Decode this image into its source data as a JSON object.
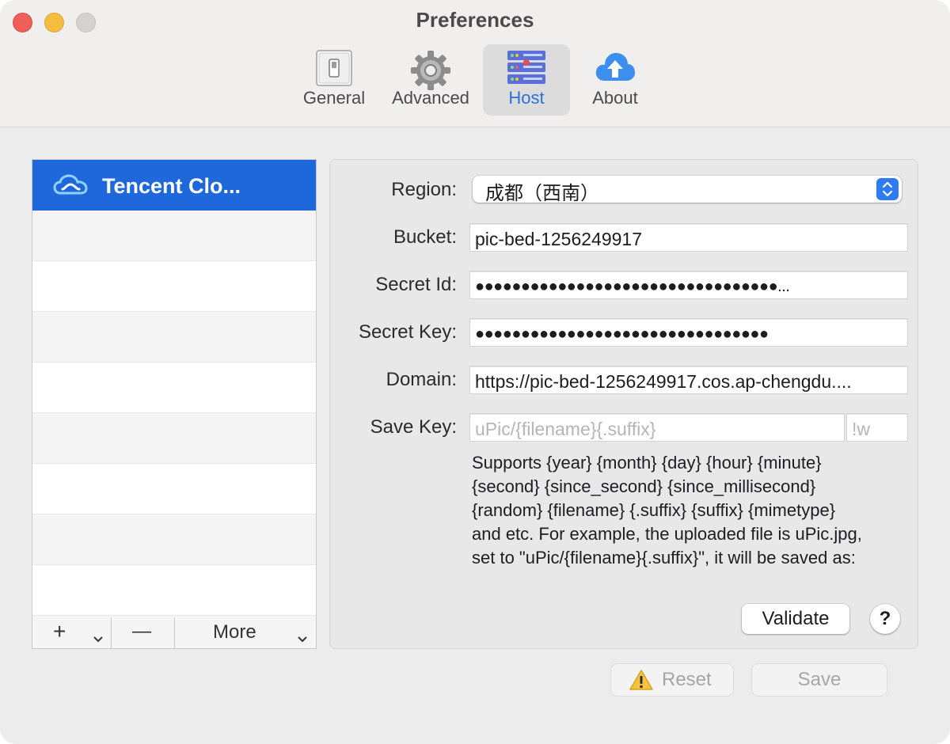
{
  "window": {
    "title": "Preferences"
  },
  "toolbar": {
    "tabs": [
      {
        "label": "General",
        "icon": "switch-icon"
      },
      {
        "label": "Advanced",
        "icon": "gear-icon"
      },
      {
        "label": "Host",
        "icon": "server-icon",
        "active": true
      },
      {
        "label": "About",
        "icon": "cloud-upload-icon"
      }
    ]
  },
  "host_list": {
    "items": [
      {
        "label": "Tencent Clo...",
        "icon": "tencent-cloud-icon",
        "selected": true
      }
    ],
    "toolbar": {
      "add": "+",
      "remove": "—",
      "more": "More"
    }
  },
  "form": {
    "region": {
      "label": "Region:",
      "value": "成都（西南）"
    },
    "bucket": {
      "label": "Bucket:",
      "value": "pic-bed-1256249917"
    },
    "secret_id": {
      "label": "Secret Id:",
      "value": "●●●●●●●●●●●●●●●●●●●●●●●●●●●●●●●●●..."
    },
    "secret_key": {
      "label": "Secret Key:",
      "value": "●●●●●●●●●●●●●●●●●●●●●●●●●●●●●●●●"
    },
    "domain": {
      "label": "Domain:",
      "value": "https://pic-bed-1256249917.cos.ap-chengdu...."
    },
    "save_key": {
      "label": "Save Key:",
      "placeholder": "uPic/{filename}{.suffix}",
      "suffix_placeholder": "!w"
    },
    "help_lines": [
      "Supports {year} {month} {day} {hour} {minute}",
      "{second} {since_second} {since_millisecond}",
      "{random} {filename} {.suffix} {suffix} {mimetype}",
      "and etc. For example, the uploaded file is uPic.jpg,",
      "set to \"uPic/{filename}{.suffix}\", it will be saved as:"
    ],
    "validate": "Validate",
    "help": "?"
  },
  "footer": {
    "reset": "Reset",
    "save": "Save"
  },
  "colors": {
    "accent": "#2a72d9",
    "selection": "#1e68dc"
  }
}
